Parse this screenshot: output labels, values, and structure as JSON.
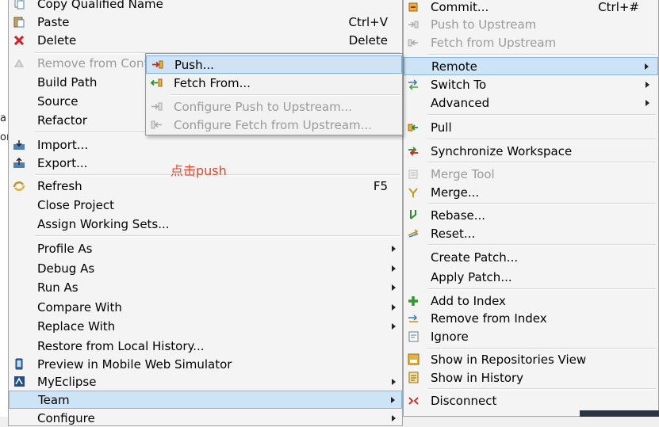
{
  "left_strip": {
    "fragment_a": "a",
    "fragment_b": "or"
  },
  "main_menu": {
    "items": [
      {
        "label": "Copy Qualified Name",
        "accel": "",
        "icon": "copy-icon",
        "disabled": false
      },
      {
        "label": "Paste",
        "accel": "Ctrl+V",
        "icon": "paste-icon",
        "disabled": false
      },
      {
        "label": "Delete",
        "accel": "Delete",
        "icon": "delete-x-icon",
        "disabled": false
      },
      {
        "label": "Remove from Cont",
        "accel": "",
        "icon": "remove-context-icon",
        "disabled": true
      },
      {
        "label": "Build Path",
        "accel": "",
        "icon": "",
        "disabled": false
      },
      {
        "label": "Source",
        "accel": "",
        "icon": "",
        "disabled": false
      },
      {
        "label": "Refactor",
        "accel": "",
        "icon": "",
        "disabled": false
      },
      {
        "label": "Import...",
        "accel": "",
        "icon": "import-icon",
        "disabled": false
      },
      {
        "label": "Export...",
        "accel": "",
        "icon": "export-icon",
        "disabled": false
      },
      {
        "label": "Refresh",
        "accel": "F5",
        "icon": "refresh-icon",
        "disabled": false
      },
      {
        "label": "Close Project",
        "accel": "",
        "icon": "",
        "disabled": false
      },
      {
        "label": "Assign Working Sets...",
        "accel": "",
        "icon": "",
        "disabled": false
      },
      {
        "label": "Profile As",
        "accel": "",
        "icon": "",
        "disabled": false
      },
      {
        "label": "Debug As",
        "accel": "",
        "icon": "",
        "disabled": false
      },
      {
        "label": "Run As",
        "accel": "",
        "icon": "",
        "disabled": false
      },
      {
        "label": "Compare With",
        "accel": "",
        "icon": "",
        "disabled": false
      },
      {
        "label": "Replace With",
        "accel": "",
        "icon": "",
        "disabled": false
      },
      {
        "label": "Restore from Local History...",
        "accel": "",
        "icon": "",
        "disabled": false
      },
      {
        "label": "Preview in Mobile Web Simulator",
        "accel": "",
        "icon": "mobile-preview-icon",
        "disabled": false
      },
      {
        "label": "MyEclipse",
        "accel": "",
        "icon": "myeclipse-icon",
        "disabled": false
      },
      {
        "label": "Team",
        "accel": "",
        "icon": "",
        "disabled": false
      },
      {
        "label": "Configure",
        "accel": "",
        "icon": "",
        "disabled": false
      }
    ]
  },
  "remote_menu": {
    "items": [
      {
        "label": "Push...",
        "icon": "push-icon",
        "disabled": false
      },
      {
        "label": "Fetch From...",
        "icon": "fetch-icon",
        "disabled": false
      },
      {
        "label": "Configure Push to Upstream...",
        "icon": "configure-push-icon",
        "disabled": true
      },
      {
        "label": "Configure Fetch from Upstream...",
        "icon": "configure-fetch-icon",
        "disabled": true
      }
    ]
  },
  "team_menu": {
    "items": [
      {
        "label": "Commit...",
        "accel": "Ctrl+#",
        "icon": "commit-icon",
        "disabled": false
      },
      {
        "label": "Push to Upstream",
        "accel": "",
        "icon": "push-upstream-icon",
        "disabled": true
      },
      {
        "label": "Fetch from Upstream",
        "accel": "",
        "icon": "fetch-upstream-icon",
        "disabled": true
      },
      {
        "label": "Remote",
        "accel": "",
        "icon": "",
        "disabled": false
      },
      {
        "label": "Switch To",
        "accel": "",
        "icon": "switch-branch-icon",
        "disabled": false
      },
      {
        "label": "Advanced",
        "accel": "",
        "icon": "",
        "disabled": false
      },
      {
        "label": "Pull",
        "accel": "",
        "icon": "pull-icon",
        "disabled": false
      },
      {
        "label": "Synchronize Workspace",
        "accel": "",
        "icon": "synchronize-icon",
        "disabled": false
      },
      {
        "label": "Merge Tool",
        "accel": "",
        "icon": "merge-tool-icon",
        "disabled": true
      },
      {
        "label": "Merge...",
        "accel": "",
        "icon": "merge-icon",
        "disabled": false
      },
      {
        "label": "Rebase...",
        "accel": "",
        "icon": "rebase-icon",
        "disabled": false
      },
      {
        "label": "Reset...",
        "accel": "",
        "icon": "reset-icon",
        "disabled": false
      },
      {
        "label": "Create Patch...",
        "accel": "",
        "icon": "",
        "disabled": false
      },
      {
        "label": "Apply Patch...",
        "accel": "",
        "icon": "",
        "disabled": false
      },
      {
        "label": "Add to Index",
        "accel": "",
        "icon": "add-index-icon",
        "disabled": false
      },
      {
        "label": "Remove from Index",
        "accel": "",
        "icon": "remove-index-icon",
        "disabled": false
      },
      {
        "label": "Ignore",
        "accel": "",
        "icon": "ignore-icon",
        "disabled": false
      },
      {
        "label": "Show in Repositories View",
        "accel": "",
        "icon": "repositories-view-icon",
        "disabled": false
      },
      {
        "label": "Show in History",
        "accel": "",
        "icon": "history-icon",
        "disabled": false
      },
      {
        "label": "Disconnect",
        "accel": "",
        "icon": "disconnect-icon",
        "disabled": false
      }
    ]
  },
  "annotation": {
    "text": "点击push",
    "color": "#e8452a"
  },
  "colors": {
    "highlight": "#cde4f7",
    "highlight_border": "#86b8e0",
    "disabled_text": "#9a9a9a"
  }
}
